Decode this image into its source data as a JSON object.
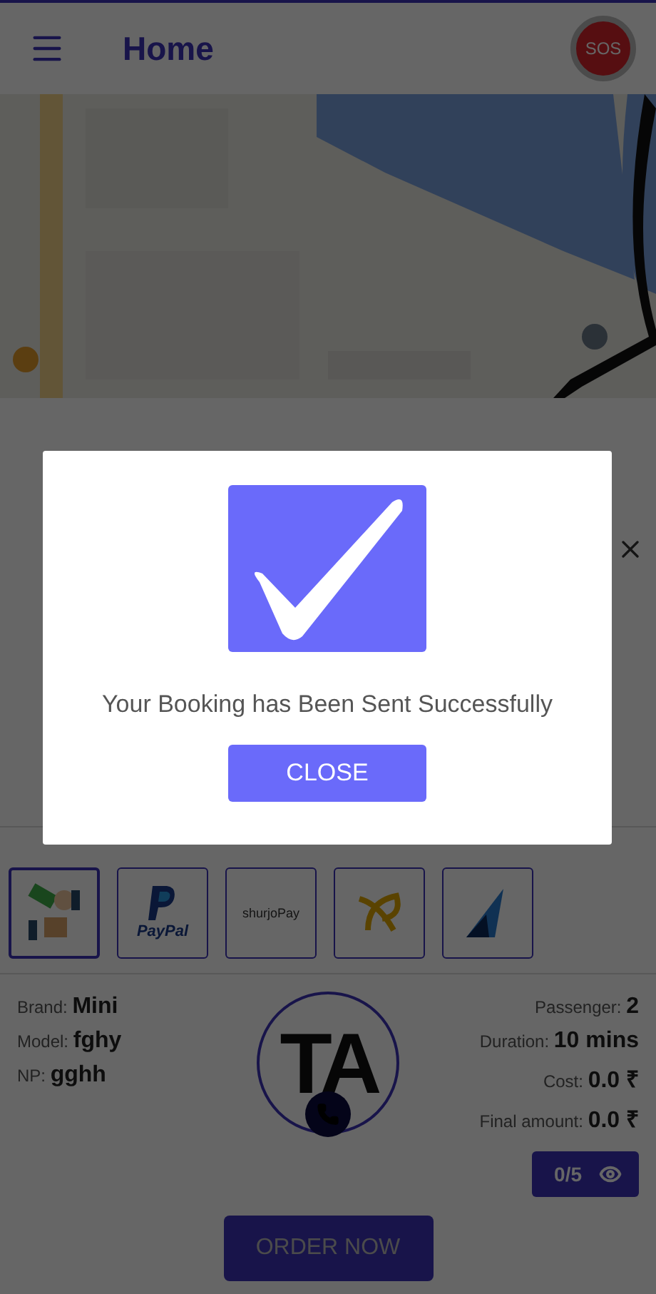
{
  "header": {
    "title": "Home",
    "sos": "SOS"
  },
  "payment": {
    "methods": [
      {
        "kind": "cash",
        "selected": true
      },
      {
        "kind": "paypal",
        "label": "PayPal",
        "selected": false
      },
      {
        "kind": "shurjopay",
        "label": "shurjoPay",
        "selected": false
      },
      {
        "kind": "swirl",
        "selected": false
      },
      {
        "kind": "arrow",
        "selected": false
      }
    ]
  },
  "ride": {
    "left": [
      {
        "label": "Brand:",
        "value": "Mini"
      },
      {
        "label": "Model:",
        "value": "fghy"
      },
      {
        "label": "NP:",
        "value": "gghh"
      }
    ],
    "right": [
      {
        "label": "Passenger:",
        "value": "2"
      },
      {
        "label": "Duration:",
        "value": "10 mins"
      },
      {
        "label": "Cost:",
        "value": "0.0 ₹"
      },
      {
        "label": "Final amount:",
        "value": "0.0 ₹"
      }
    ],
    "driver_initials": "TA",
    "rating": "0/5",
    "order_button": "ORDER NOW"
  },
  "dialog": {
    "message": "Your Booking has Been Sent Successfully",
    "button": "CLOSE"
  }
}
